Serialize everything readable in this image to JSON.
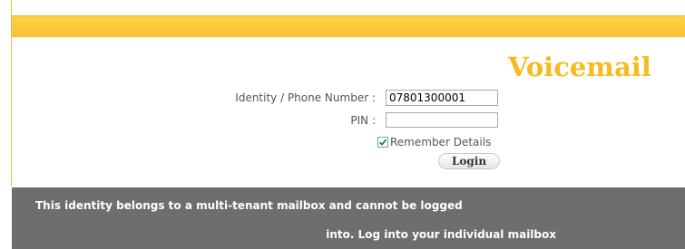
{
  "header": {
    "title": "Voicemail"
  },
  "form": {
    "identity_label": "Identity / Phone Number :",
    "identity_value": "07801300001",
    "pin_label": "PIN :",
    "pin_value": "",
    "remember_label": "Remember Details",
    "remember_checked": true,
    "login_label": "Login"
  },
  "message": {
    "line1": "This identity belongs to a multi-tenant mailbox and cannot be logged",
    "line2": "into. Log into your individual mailbox"
  },
  "colors": {
    "accent": "#f6bb1c",
    "banner": "#6e6e6e"
  }
}
